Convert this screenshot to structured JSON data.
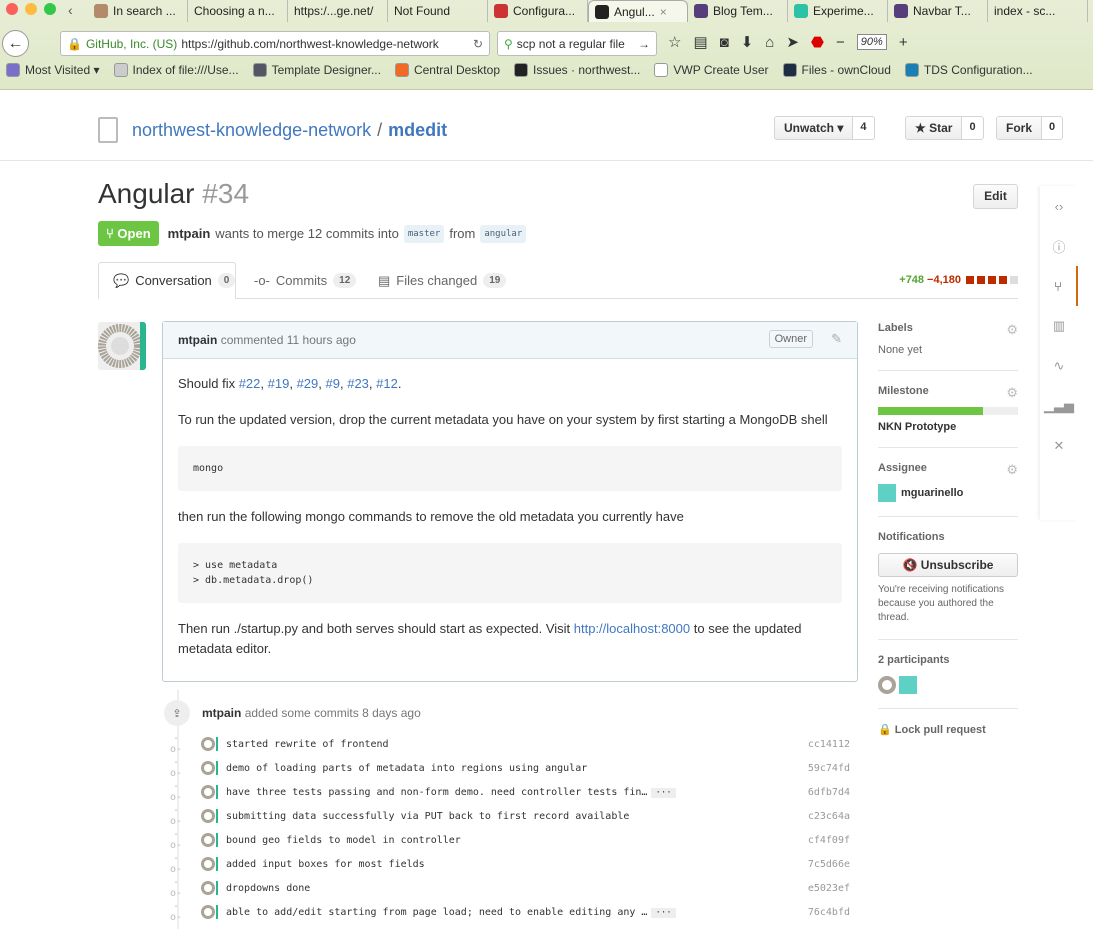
{
  "browser": {
    "tabs": [
      {
        "label": "In search ...",
        "color": "#b38a6a"
      },
      {
        "label": "Choosing a n...",
        "color": ""
      },
      {
        "label": "https:/...ge.net/",
        "color": ""
      },
      {
        "label": "Not Found",
        "color": ""
      },
      {
        "label": "Configura...",
        "color": "#c33"
      },
      {
        "label": "Angul...",
        "color": "#222",
        "active": true
      },
      {
        "label": "Blog Tem...",
        "color": "#563d7c"
      },
      {
        "label": "Experime...",
        "color": "#2cc2a5"
      },
      {
        "label": "Navbar T...",
        "color": "#563d7c"
      },
      {
        "label": "index - sc...",
        "color": ""
      }
    ],
    "identity": "GitHub, Inc. (US)",
    "url": "https://github.com/northwest-knowledge-network",
    "search": "scp not a regular file",
    "zoom": "90%",
    "bookmarks": [
      {
        "label": "Most Visited ▾",
        "color": "#7a6fc9"
      },
      {
        "label": "Index of file:///Use...",
        "color": "#ccc"
      },
      {
        "label": "Template Designer...",
        "color": "#556"
      },
      {
        "label": "Central Desktop",
        "color": "#f06a25"
      },
      {
        "label": "Issues · northwest...",
        "color": "#222"
      },
      {
        "label": "VWP Create User",
        "color": "#fff"
      },
      {
        "label": "Files - ownCloud",
        "color": "#1d2d44"
      },
      {
        "label": "TDS Configuration...",
        "color": "#1a7fb5"
      }
    ]
  },
  "repo": {
    "owner": "northwest-knowledge-network",
    "sep": "/",
    "name": "mdedit",
    "unwatch": "Unwatch ▾",
    "unwatch_count": "4",
    "star": "★ Star",
    "star_count": "0",
    "fork": "Fork",
    "fork_count": "0"
  },
  "pr": {
    "title": "Angular",
    "number": "#34",
    "edit": "Edit",
    "state": "Open",
    "author": "mtpain",
    "meta_text": "wants to merge 12 commits into",
    "base": "master",
    "from": "from",
    "head": "angular"
  },
  "tabs": [
    {
      "label": "Conversation",
      "count": "0"
    },
    {
      "label": "Commits",
      "count": "12"
    },
    {
      "label": "Files changed",
      "count": "19"
    }
  ],
  "diffstat": {
    "added": "+748",
    "removed": "−4,180"
  },
  "comment": {
    "author": "mtpain",
    "action": "commented",
    "time": "11 hours ago",
    "badge": "Owner",
    "p1_prefix": "Should fix ",
    "links": [
      "#22",
      ", ",
      "#19",
      ", ",
      "#29",
      ", ",
      "#9",
      ", ",
      "#23",
      ", ",
      "#12",
      "."
    ],
    "p2": "To run the updated version, drop the current metadata you have on your system by first starting a MongoDB shell",
    "code1": "mongo",
    "p3": "then run the following mongo commands to remove the old metadata you currently have",
    "code2": "> use metadata\n> db.metadata.drop()",
    "p4a": "Then run ./startup.py and both serves should start as expected. Visit ",
    "p4link": "http://localhost:8000",
    "p4b": " to see the updated metadata editor."
  },
  "event": {
    "author": "mtpain",
    "text": "added some commits 8 days ago"
  },
  "commits": [
    {
      "msg": "started rewrite of frontend",
      "sha": "cc14112"
    },
    {
      "msg": "demo of loading parts of metadata into regions using angular",
      "sha": "59c74fd"
    },
    {
      "msg": "have three tests passing and non-form demo. need controller tests fin…",
      "sha": "6dfb7d4",
      "more": "···"
    },
    {
      "msg": "submitting data successfully via PUT back to first record available",
      "sha": "c23c64a"
    },
    {
      "msg": "bound geo fields to model in controller",
      "sha": "cf4f09f"
    },
    {
      "msg": "added input boxes for most fields",
      "sha": "7c5d66e"
    },
    {
      "msg": "dropdowns done",
      "sha": "e5023ef"
    },
    {
      "msg": "able to add/edit starting from page load; need to enable editing any …",
      "sha": "76c4bfd",
      "more": "···"
    }
  ],
  "sidebar": {
    "labels_title": "Labels",
    "labels_val": "None yet",
    "milestone_title": "Milestone",
    "milestone_progress": 0.75,
    "milestone_name": "NKN Prototype",
    "assignee_title": "Assignee",
    "assignee": "mguarinello",
    "notif_title": "Notifications",
    "unsubscribe": "🔇 Unsubscribe",
    "notif_note": "You're receiving notifications because you authored the thread.",
    "participants": "2 participants",
    "lock": "🔒 Lock pull request"
  }
}
